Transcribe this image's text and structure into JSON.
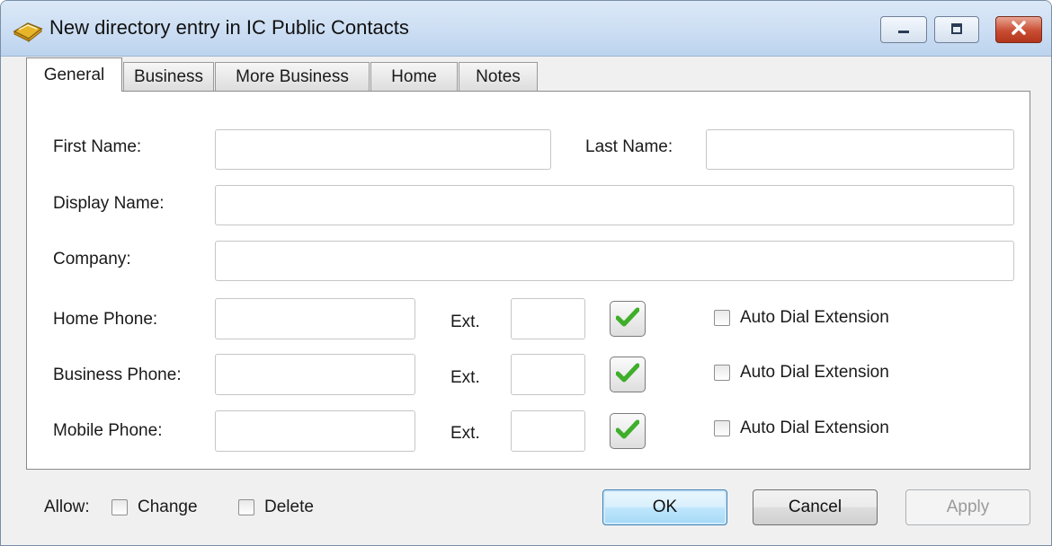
{
  "window": {
    "title": "New directory entry in IC Public Contacts",
    "icon": "address-book-icon",
    "controls": [
      "minimize-icon",
      "maximize-icon",
      "close-icon"
    ]
  },
  "tabs": [
    {
      "label": "General",
      "active": true
    },
    {
      "label": "Business",
      "active": false
    },
    {
      "label": "More Business",
      "active": false
    },
    {
      "label": "Home",
      "active": false
    },
    {
      "label": "Notes",
      "active": false
    }
  ],
  "form": {
    "first_name": {
      "label": "First Name:",
      "value": ""
    },
    "last_name": {
      "label": "Last Name:",
      "value": ""
    },
    "display_name": {
      "label": "Display Name:",
      "value": ""
    },
    "company": {
      "label": "Company:",
      "value": ""
    },
    "phones": [
      {
        "label": "Home Phone:",
        "value": "",
        "ext_label": "Ext.",
        "ext_value": "",
        "auto_dial_label": "Auto Dial Extension",
        "auto_dial": false
      },
      {
        "label": "Business Phone:",
        "value": "",
        "ext_label": "Ext.",
        "ext_value": "",
        "auto_dial_label": "Auto Dial Extension",
        "auto_dial": false
      },
      {
        "label": "Mobile Phone:",
        "value": "",
        "ext_label": "Ext.",
        "ext_value": "",
        "auto_dial_label": "Auto Dial Extension",
        "auto_dial": false
      }
    ]
  },
  "footer": {
    "allow_label": "Allow:",
    "change_label": "Change",
    "delete_label": "Delete",
    "ok_label": "OK",
    "cancel_label": "Cancel",
    "apply_label": "Apply"
  },
  "colors": {
    "check_green": "#3fae2a",
    "default_button_border": "#3c7fb1",
    "close_button": "#c94d32"
  }
}
